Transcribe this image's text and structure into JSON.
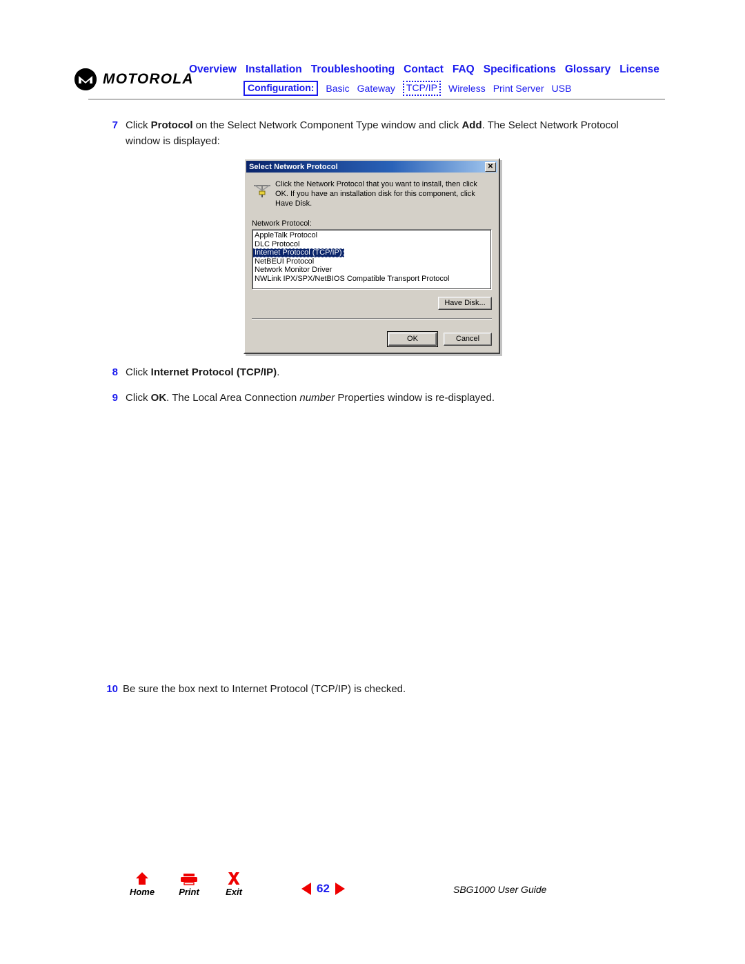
{
  "header": {
    "brand": "MOTOROLA",
    "brand_icon": "motorola-batwing-icon",
    "primary_nav": [
      "Overview",
      "Installation",
      "Troubleshooting",
      "Contact",
      "FAQ",
      "Specifications",
      "Glossary",
      "License"
    ],
    "secondary_nav": {
      "label": "Configuration:",
      "items": [
        "Basic",
        "Gateway",
        "TCP/IP",
        "Wireless",
        "Print Server",
        "USB"
      ],
      "active": "TCP/IP"
    },
    "accent_color": "#1a1aee"
  },
  "steps": {
    "s7": {
      "num": "7",
      "p1": "Click ",
      "b1": "Protocol",
      "p2": " on the Select Network Component Type window and click ",
      "b2": "Add",
      "p3": ". The Select Network Protocol window is displayed:"
    },
    "s8": {
      "num": "8",
      "p1": "Click ",
      "b1": "Internet Protocol (TCP/IP)",
      "p2": "."
    },
    "s9": {
      "num": "9",
      "p1": "Click ",
      "b1": "OK",
      "p2": ". The Local Area Connection ",
      "i1": "number",
      "p3": " Properties window is re-displayed."
    },
    "s10": {
      "num": "10",
      "p1": "Be sure the box next to Internet Protocol (TCP/IP) is checked."
    }
  },
  "dialog": {
    "title": "Select Network Protocol",
    "close_label": "✕",
    "icon": "network-protocol-icon",
    "instruction": "Click the Network Protocol that you want to install, then click OK. If you have an installation disk for this component, click Have Disk.",
    "field_label": "Network Protocol:",
    "protocols": [
      "AppleTalk Protocol",
      "DLC Protocol",
      "Internet Protocol (TCP/IP)",
      "NetBEUI Protocol",
      "Network Monitor Driver",
      "NWLink IPX/SPX/NetBIOS Compatible Transport Protocol"
    ],
    "selected_protocol": "Internet Protocol (TCP/IP)",
    "have_disk_label": "Have Disk...",
    "ok_label": "OK",
    "cancel_label": "Cancel"
  },
  "footer": {
    "home_label": "Home",
    "print_label": "Print",
    "exit_label": "Exit",
    "page_number": "62",
    "guide_title": "SBG1000 User Guide",
    "icon_color": "#ee0000"
  }
}
